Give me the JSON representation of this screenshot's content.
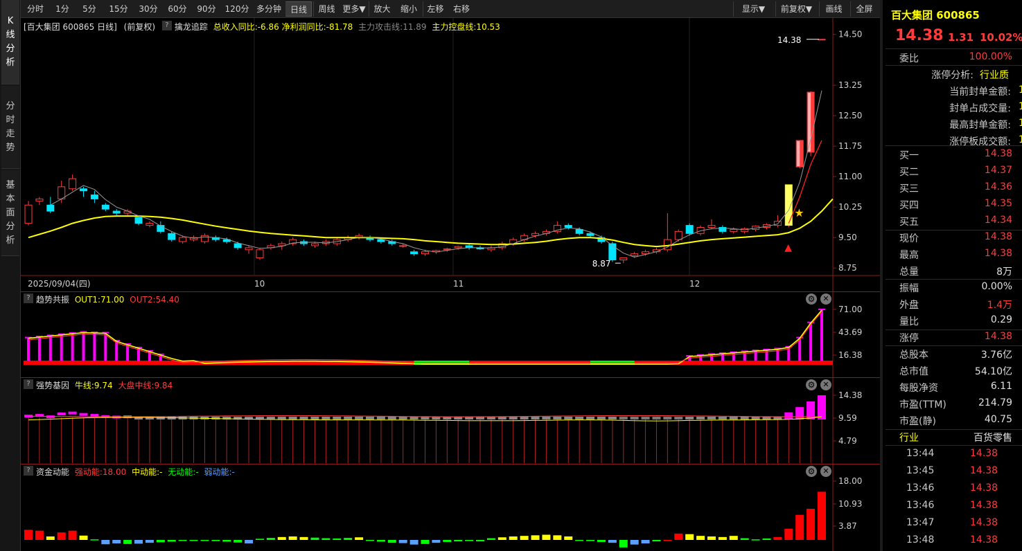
{
  "tabs": {
    "kline": [
      "K",
      "线",
      "分",
      "析"
    ],
    "intraday": [
      "分",
      "时",
      "走",
      "势"
    ],
    "fundamental": [
      "基",
      "本",
      "面",
      "分",
      "析"
    ]
  },
  "toolbar": {
    "left": [
      "分时",
      "1分",
      "5分",
      "15分",
      "30分",
      "60分",
      "90分",
      "120分",
      "多分钟",
      "日线",
      "周线",
      "更多▼",
      "放大",
      "缩小",
      "左移",
      "右移"
    ],
    "active": "日线",
    "right": [
      "显示▼",
      "前复权▼",
      "画线",
      "全屏"
    ]
  },
  "main": {
    "header_stock": "[百大集团 600865 日线]",
    "header_adj": "(前复权)",
    "indicator_name": "擒龙追踪",
    "indicator_values": "总收入同比:-6.86 净利润同比:-81.78",
    "attack_line": "主力攻击线:11.89",
    "control_line": "主力控盘线:10.53",
    "price_labels": [
      "14.50",
      "13.25",
      "12.50",
      "11.75",
      "11.00",
      "10.25",
      "9.50",
      "8.75"
    ],
    "high_marker": "14.38",
    "low_marker": "8.87",
    "date_labels": [
      "2025/09/04(四)",
      "10",
      "11",
      "12"
    ]
  },
  "panel1": {
    "name": "趋势共振",
    "out1": "OUT1:71.00",
    "out2": "OUT2:54.40",
    "axis": [
      "71.00",
      "43.69",
      "16.38"
    ]
  },
  "panel2": {
    "name": "强势基因",
    "line1": "牛线:9.74",
    "line2": "大盘中线:9.84",
    "axis": [
      "14.38",
      "9.59",
      "4.79"
    ]
  },
  "panel3": {
    "name": "资金动能",
    "s1": "强动能:18.00",
    "s2": "中动能:-",
    "s3": "无动能:-",
    "s4": "弱动能:-",
    "axis": [
      "18.00",
      "10.93",
      "3.87"
    ]
  },
  "quote": {
    "name_code": "百大集团 600865",
    "price": "14.38",
    "change": "1.31",
    "pct": "10.02%",
    "webi_label": "委比",
    "webi_value": "100.00%",
    "limit_analysis": [
      {
        "label": "涨停分析:",
        "value": "行业质"
      },
      {
        "label": "当前封单金额:",
        "value": "1"
      },
      {
        "label": "封单占成交量:",
        "value": "1"
      },
      {
        "label": "最高封单金额:",
        "value": "1"
      },
      {
        "label": "涨停板成交额:",
        "value": "1"
      }
    ],
    "bids": [
      {
        "label": "买一",
        "value": "14.38"
      },
      {
        "label": "买二",
        "value": "14.37"
      },
      {
        "label": "买三",
        "value": "14.36"
      },
      {
        "label": "买四",
        "value": "14.35"
      },
      {
        "label": "买五",
        "value": "14.34"
      }
    ],
    "stats1": [
      {
        "label": "现价",
        "value": "14.38",
        "color": "#ff3b3b"
      },
      {
        "label": "最高",
        "value": "14.38",
        "color": "#ff3b3b"
      },
      {
        "label": "总量",
        "value": "8万",
        "color": "#e0e0e0"
      }
    ],
    "stats2": [
      {
        "label": "振幅",
        "value": "0.00%",
        "color": "#e0e0e0"
      },
      {
        "label": "外盘",
        "value": "1.4万",
        "color": "#ff3b3b"
      },
      {
        "label": "量比",
        "value": "0.29",
        "color": "#e0e0e0"
      }
    ],
    "limit_up": {
      "label": "涨停",
      "value": "14.38"
    },
    "fund": [
      {
        "label": "总股本",
        "value": "3.76亿"
      },
      {
        "label": "总市值",
        "value": "54.10亿"
      },
      {
        "label": "每股净资",
        "value": "6.11"
      },
      {
        "label": "市盈(TTM)",
        "value": "214.79"
      },
      {
        "label": "市盈(静)",
        "value": "40.75"
      }
    ],
    "industry_label": "行业",
    "industry_value": "百货零售",
    "ticks": [
      {
        "time": "13:44",
        "price": "14.38"
      },
      {
        "time": "13:45",
        "price": "14.38"
      },
      {
        "time": "13:46",
        "price": "14.38"
      },
      {
        "time": "13:46",
        "price": "14.38"
      },
      {
        "time": "13:47",
        "price": "14.38"
      },
      {
        "time": "13:48",
        "price": "14.38"
      }
    ]
  },
  "colors": {
    "up": "#ff3b3b",
    "down": "#00e5ff",
    "ma": "#ffff00",
    "accent_red": "#ff2020",
    "magenta": "#ff00ff",
    "green": "#00ff00"
  },
  "chart_data": {
    "type": "candlestick",
    "series": [
      {
        "name": "price",
        "ohlc": [
          [
            9.85,
            10.4,
            9.8,
            10.3
          ],
          [
            10.4,
            10.5,
            10.3,
            10.45
          ],
          [
            10.3,
            10.5,
            10.1,
            10.15
          ],
          [
            10.45,
            10.9,
            10.35,
            10.75
          ],
          [
            10.7,
            11.05,
            10.65,
            10.95
          ],
          [
            10.7,
            10.75,
            10.5,
            10.65
          ],
          [
            10.55,
            10.65,
            10.35,
            10.45
          ],
          [
            10.3,
            10.35,
            10.15,
            10.2
          ],
          [
            10.15,
            10.2,
            10.05,
            10.1
          ],
          [
            10.1,
            10.2,
            10.05,
            10.15
          ],
          [
            10.0,
            10.0,
            9.8,
            9.85
          ],
          [
            9.8,
            9.9,
            9.75,
            9.85
          ],
          [
            9.8,
            9.9,
            9.6,
            9.65
          ],
          [
            9.6,
            9.65,
            9.4,
            9.45
          ],
          [
            9.4,
            9.55,
            9.35,
            9.5
          ],
          [
            9.45,
            9.55,
            9.4,
            9.5
          ],
          [
            9.4,
            9.6,
            9.35,
            9.55
          ],
          [
            9.5,
            9.55,
            9.4,
            9.45
          ],
          [
            9.45,
            9.5,
            9.35,
            9.4
          ],
          [
            9.35,
            9.4,
            9.2,
            9.25
          ],
          [
            9.2,
            9.3,
            9.1,
            9.25
          ],
          [
            9.0,
            9.25,
            8.95,
            9.2
          ],
          [
            9.25,
            9.35,
            9.2,
            9.3
          ],
          [
            9.3,
            9.4,
            9.2,
            9.35
          ],
          [
            9.35,
            9.5,
            9.3,
            9.45
          ],
          [
            9.4,
            9.45,
            9.3,
            9.35
          ],
          [
            9.3,
            9.4,
            9.25,
            9.35
          ],
          [
            9.35,
            9.45,
            9.3,
            9.4
          ],
          [
            9.35,
            9.5,
            9.3,
            9.45
          ],
          [
            9.45,
            9.55,
            9.4,
            9.5
          ],
          [
            9.5,
            9.6,
            9.45,
            9.55
          ],
          [
            9.5,
            9.55,
            9.4,
            9.45
          ],
          [
            9.45,
            9.5,
            9.35,
            9.4
          ],
          [
            9.4,
            9.45,
            9.3,
            9.35
          ],
          [
            9.3,
            9.35,
            9.25,
            9.3
          ],
          [
            9.15,
            9.2,
            9.05,
            9.1
          ],
          [
            9.1,
            9.2,
            9.05,
            9.15
          ],
          [
            9.15,
            9.2,
            9.1,
            9.18
          ],
          [
            9.2,
            9.25,
            9.15,
            9.22
          ],
          [
            9.25,
            9.3,
            9.2,
            9.28
          ],
          [
            9.3,
            9.35,
            9.2,
            9.25
          ],
          [
            9.25,
            9.3,
            9.2,
            9.22
          ],
          [
            9.2,
            9.3,
            9.15,
            9.25
          ],
          [
            9.25,
            9.4,
            9.2,
            9.35
          ],
          [
            9.35,
            9.5,
            9.3,
            9.45
          ],
          [
            9.45,
            9.6,
            9.4,
            9.55
          ],
          [
            9.55,
            9.65,
            9.5,
            9.6
          ],
          [
            9.6,
            9.7,
            9.55,
            9.65
          ],
          [
            9.65,
            9.9,
            9.6,
            9.8
          ],
          [
            9.8,
            9.85,
            9.7,
            9.75
          ],
          [
            9.7,
            9.75,
            9.55,
            9.6
          ],
          [
            9.6,
            9.65,
            9.5,
            9.55
          ],
          [
            9.5,
            9.55,
            9.35,
            9.4
          ],
          [
            9.35,
            9.4,
            8.9,
            8.95
          ],
          [
            8.95,
            9.0,
            8.87,
            9.0
          ],
          [
            9.05,
            9.15,
            9.0,
            9.1
          ],
          [
            9.1,
            9.2,
            9.05,
            9.15
          ],
          [
            9.15,
            9.25,
            9.1,
            9.2
          ],
          [
            9.2,
            10.1,
            9.15,
            9.45
          ],
          [
            9.45,
            9.7,
            9.4,
            9.65
          ],
          [
            9.8,
            9.85,
            9.55,
            9.6
          ],
          [
            9.6,
            9.8,
            9.55,
            9.75
          ],
          [
            9.75,
            9.95,
            9.7,
            9.8
          ],
          [
            9.75,
            9.8,
            9.6,
            9.65
          ],
          [
            9.65,
            9.75,
            9.6,
            9.7
          ],
          [
            9.65,
            9.75,
            9.6,
            9.72
          ],
          [
            9.7,
            9.8,
            9.65,
            9.78
          ],
          [
            9.75,
            9.85,
            9.7,
            9.82
          ],
          [
            9.8,
            10.05,
            9.75,
            9.9
          ],
          [
            9.8,
            10.8,
            9.75,
            10.8
          ],
          [
            11.24,
            11.89,
            11.2,
            11.89
          ],
          [
            11.6,
            13.1,
            11.5,
            13.08
          ],
          [
            14.38,
            14.38,
            14.38,
            14.38
          ]
        ]
      }
    ],
    "ma_main": [
      9.5,
      9.58,
      9.66,
      9.75,
      9.85,
      9.92,
      9.98,
      10.02,
      10.03,
      10.03,
      10.03,
      10.02,
      10.0,
      9.97,
      9.93,
      9.88,
      9.83,
      9.78,
      9.74,
      9.7,
      9.66,
      9.63,
      9.6,
      9.58,
      9.56,
      9.54,
      9.52,
      9.5,
      9.5,
      9.5,
      9.5,
      9.5,
      9.49,
      9.48,
      9.47,
      9.45,
      9.42,
      9.4,
      9.38,
      9.36,
      9.35,
      9.34,
      9.33,
      9.33,
      9.34,
      9.36,
      9.38,
      9.41,
      9.45,
      9.48,
      9.5,
      9.5,
      9.48,
      9.44,
      9.38,
      9.33,
      9.3,
      9.28,
      9.3,
      9.34,
      9.38,
      9.42,
      9.45,
      9.47,
      9.49,
      9.51,
      9.53,
      9.55,
      9.57,
      9.62,
      9.73,
      9.9,
      10.15,
      10.45
    ],
    "ylim": [
      8.6,
      14.7
    ]
  }
}
